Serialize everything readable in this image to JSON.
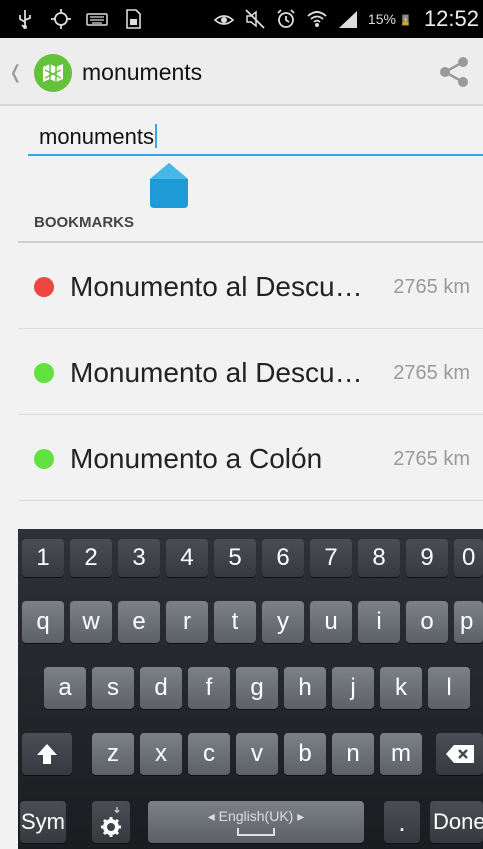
{
  "status_bar": {
    "battery_percent": "15%",
    "time": "12:52",
    "icons": [
      "usb-icon",
      "gps-icon",
      "keyboard-icon",
      "sd-card-icon",
      "smart-stay-eye-icon",
      "mute-icon",
      "alarm-icon",
      "wifi-icon",
      "signal-icon",
      "battery-charging-icon"
    ]
  },
  "action_bar": {
    "title": "monuments",
    "up_icon": "chevron-left-icon",
    "logo_icon": "app-logo-icon",
    "share_icon": "share-icon"
  },
  "search": {
    "value": "monuments"
  },
  "bookmarks": {
    "header": "BOOKMARKS",
    "items": [
      {
        "name": "Monumento al Descu…",
        "distance": "2765 km",
        "color": "#f04640"
      },
      {
        "name": "Monumento al Descu…",
        "distance": "2765 km",
        "color": "#62e23e"
      },
      {
        "name": "Monumento a Colón",
        "distance": "2765 km",
        "color": "#62e23e"
      }
    ]
  },
  "keyboard": {
    "number_row": [
      "1",
      "2",
      "3",
      "4",
      "5",
      "6",
      "7",
      "8",
      "9",
      "0"
    ],
    "row1": [
      "q",
      "w",
      "e",
      "r",
      "t",
      "y",
      "u",
      "i",
      "o",
      "p"
    ],
    "row2": [
      "a",
      "s",
      "d",
      "f",
      "g",
      "h",
      "j",
      "k",
      "l"
    ],
    "row3": [
      "z",
      "x",
      "c",
      "v",
      "b",
      "n",
      "m"
    ],
    "sym_label": "Sym",
    "space_label": "English(UK)",
    "period_label": ".",
    "done_label": "Done",
    "shift_icon": "shift-arrow-icon",
    "backspace_icon": "backspace-icon",
    "settings_icon": "gear-mic-icon"
  },
  "colors": {
    "accent": "#33a9dc",
    "logo_green": "#64c23a"
  }
}
